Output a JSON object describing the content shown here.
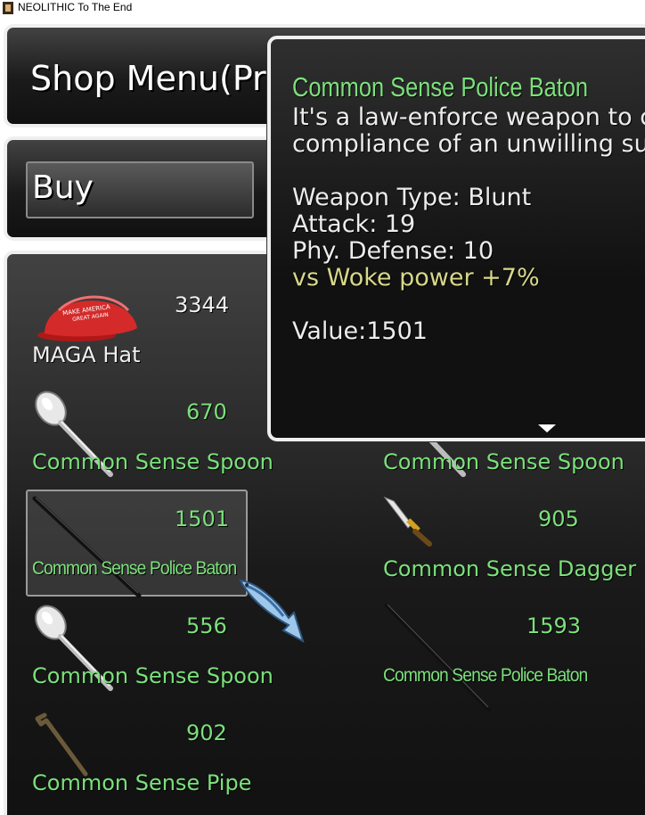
{
  "window": {
    "title": "NEOLITHIC To The End"
  },
  "shop": {
    "title": "Shop Menu(Pre",
    "mode_label": "Buy"
  },
  "items": [
    {
      "name": "MAGA Hat",
      "price": "3344",
      "icon": "maga-hat-icon"
    },
    {
      "name": "Common Sense Spoon",
      "price": "670",
      "icon": "spoon-icon"
    },
    {
      "name": "Common Sense Spoon",
      "price": "",
      "icon": "spoon-icon"
    },
    {
      "name": "Common Sense Police Baton",
      "price": "1501",
      "icon": "baton-icon"
    },
    {
      "name": "Common Sense Dagger",
      "price": "905",
      "icon": "dagger-icon"
    },
    {
      "name": "Common Sense Spoon",
      "price": "556",
      "icon": "spoon-icon"
    },
    {
      "name": "Common Sense Police Baton",
      "price": "1593",
      "icon": "baton-icon"
    },
    {
      "name": "Common Sense Pipe",
      "price": "902",
      "icon": "pipe-icon"
    }
  ],
  "tooltip": {
    "name": "Common Sense Police Baton",
    "desc_line1": "It's a law-enforce weapon to c",
    "desc_line2": "compliance of an unwilling subj",
    "weapon_type": "Weapon Type: Blunt",
    "attack": "Attack: 19",
    "defense": "Phy. Defense: 10",
    "bonus": "vs Woke power +7%",
    "value": "Value:1501"
  },
  "colors": {
    "item_green": "#7be07b",
    "bonus_yellow": "#d7d78a",
    "frame": "#efefef"
  }
}
